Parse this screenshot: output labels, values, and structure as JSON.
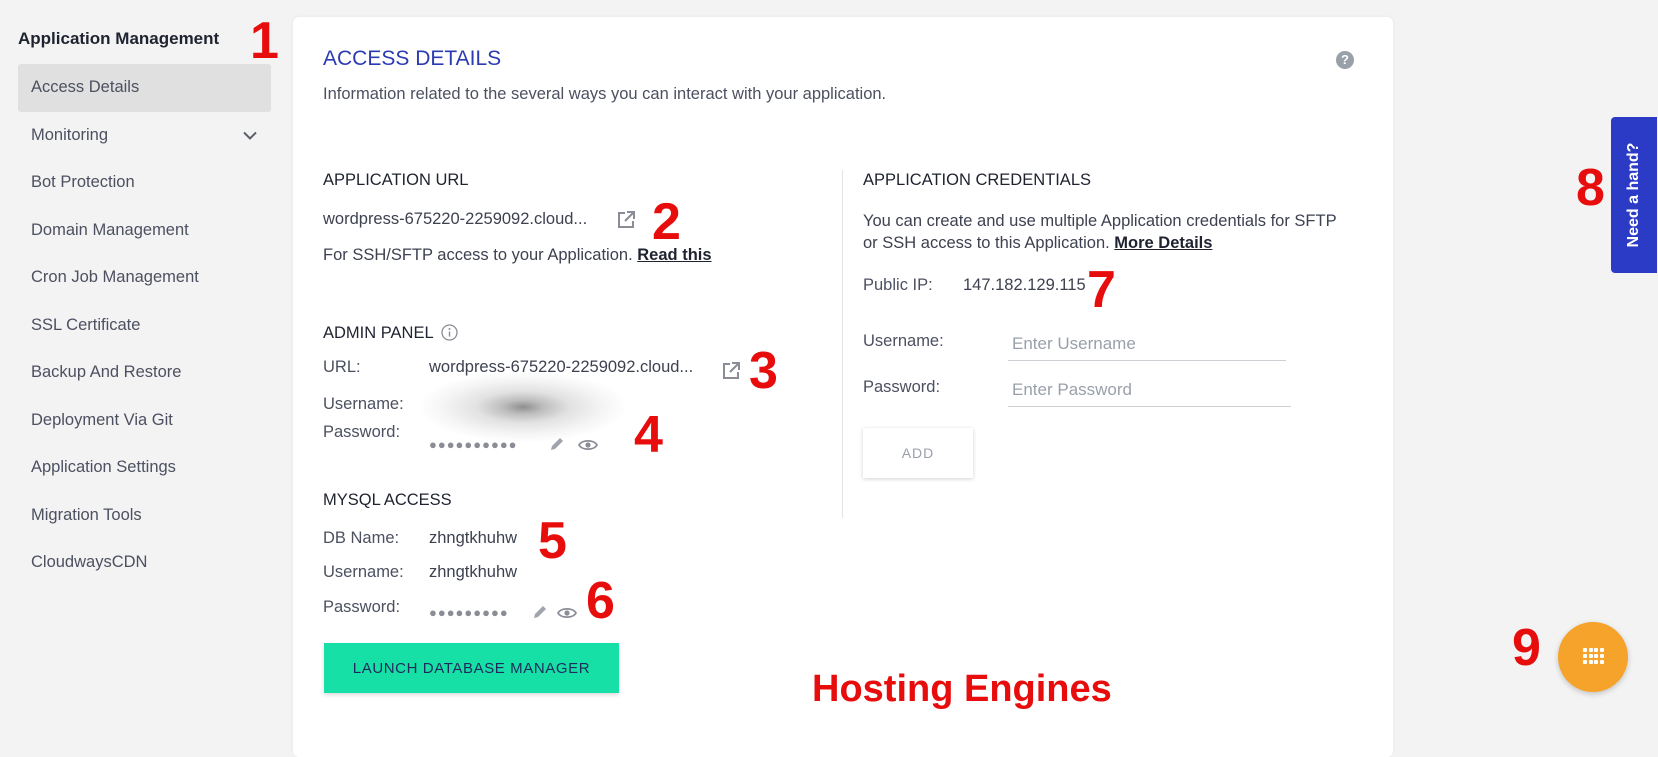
{
  "sidebar": {
    "title": "Application Management",
    "items": [
      {
        "label": "Access Details"
      },
      {
        "label": "Monitoring"
      },
      {
        "label": "Bot Protection"
      },
      {
        "label": "Domain Management"
      },
      {
        "label": "Cron Job Management"
      },
      {
        "label": "SSL Certificate"
      },
      {
        "label": "Backup And Restore"
      },
      {
        "label": "Deployment Via Git"
      },
      {
        "label": "Application Settings"
      },
      {
        "label": "Migration Tools"
      },
      {
        "label": "CloudwaysCDN"
      }
    ]
  },
  "main": {
    "title": "ACCESS DETAILS",
    "subtitle": "Information related to the several ways you can interact with your application.",
    "help_icon": "?",
    "app_url": {
      "heading": "APPLICATION URL",
      "url": "wordpress-675220-2259092.cloud...",
      "note": "For SSH/SFTP access to your Application.",
      "note_link": "Read this"
    },
    "admin_panel": {
      "heading": "ADMIN PANEL",
      "url_label": "URL:",
      "url": "wordpress-675220-2259092.cloud...",
      "username_label": "Username:",
      "password_label": "Password:",
      "password_mask": "●●●●●●●●●●"
    },
    "mysql": {
      "heading": "MYSQL ACCESS",
      "db_label": "DB Name:",
      "db_value": "zhngtkhuhw",
      "username_label": "Username:",
      "username_value": "zhngtkhuhw",
      "password_label": "Password:",
      "password_mask": "●●●●●●●●●",
      "launch_label": "LAUNCH DATABASE MANAGER"
    },
    "credentials": {
      "heading": "APPLICATION CREDENTIALS",
      "desc_line1": "You can create and use multiple Application credentials for SFTP",
      "desc_line2": "or SSH access to this Application.",
      "desc_link": "More Details",
      "public_ip_label": "Public IP:",
      "public_ip": "147.182.129.115",
      "username_label": "Username:",
      "username_placeholder": "Enter Username",
      "password_label": "Password:",
      "password_placeholder": "Enter Password",
      "add_label": "ADD"
    }
  },
  "help_tab": {
    "label": "Need a hand?"
  },
  "annotations": {
    "n1": "1",
    "n2": "2",
    "n3": "3",
    "n4": "4",
    "n5": "5",
    "n6": "6",
    "n7": "7",
    "n8": "8",
    "n9": "9",
    "watermark": "Hosting Engines"
  },
  "colors": {
    "accent": "#2c3bb1",
    "launch_button": "#16e0a6",
    "fab": "#f6a32b",
    "help_tab": "#2c3bc6",
    "annotation": "#e80d0d"
  }
}
